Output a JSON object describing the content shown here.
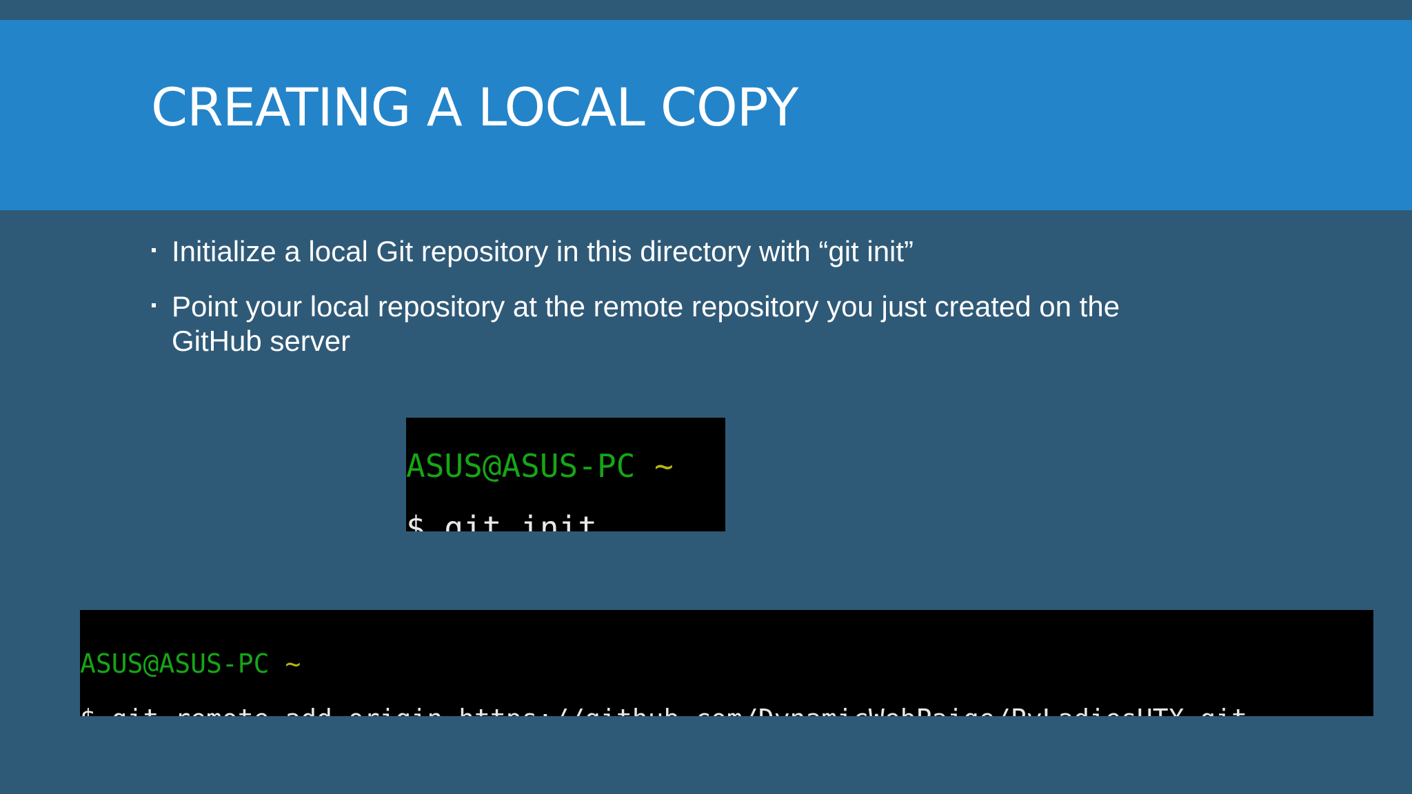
{
  "slide": {
    "title": "CREATING A LOCAL COPY",
    "bullets": [
      "Initialize a local Git repository in this directory with “git init”",
      "Point your local repository at the remote repository you just created on the GitHub server"
    ]
  },
  "terminal_init": {
    "user_host": "ASUS@ASUS-PC",
    "path": "~",
    "command": "$ git init"
  },
  "terminal_remote": {
    "user_host": "ASUS@ASUS-PC",
    "path": "~",
    "command": "$ git remote add origin https://github.com/DynamicWebPaige/PyLadiesHTX.git"
  },
  "colors": {
    "background": "#2f5a77",
    "title_bar": "#2484c9",
    "terminal_bg": "#000000",
    "terminal_user_host": "#16a616",
    "terminal_tilde": "#b8b514",
    "terminal_text": "#e8e8e8"
  }
}
